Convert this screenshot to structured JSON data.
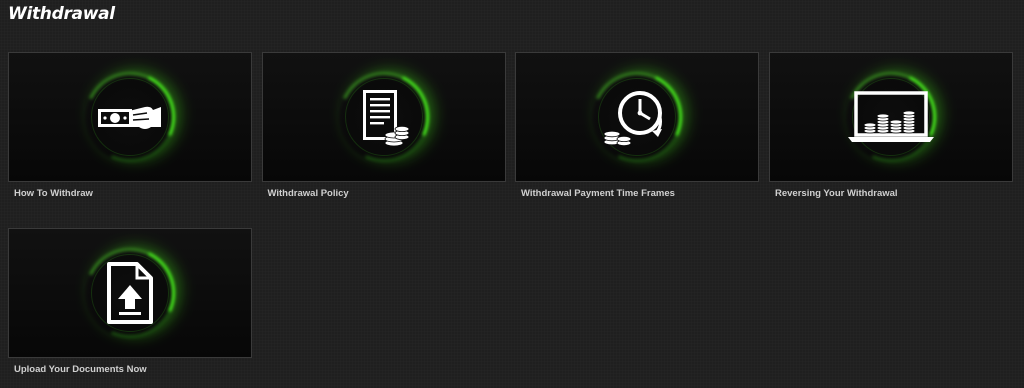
{
  "page": {
    "title": "Withdrawal"
  },
  "cards": [
    {
      "label": "How To Withdraw",
      "icon": "cash-hand-icon"
    },
    {
      "label": "Withdrawal Policy",
      "icon": "policy-document-coins-icon"
    },
    {
      "label": "Withdrawal Payment Time Frames",
      "icon": "clock-coins-icon"
    },
    {
      "label": "Reversing Your Withdrawal",
      "icon": "laptop-coins-icon"
    },
    {
      "label": "Upload Your Documents Now",
      "icon": "upload-document-icon"
    }
  ],
  "colors": {
    "background": "#1f1f1f",
    "card_background": "#0c0c0c",
    "accent_glow": "#4cff1e",
    "text": "#d0d0d0",
    "title": "#ffffff"
  }
}
